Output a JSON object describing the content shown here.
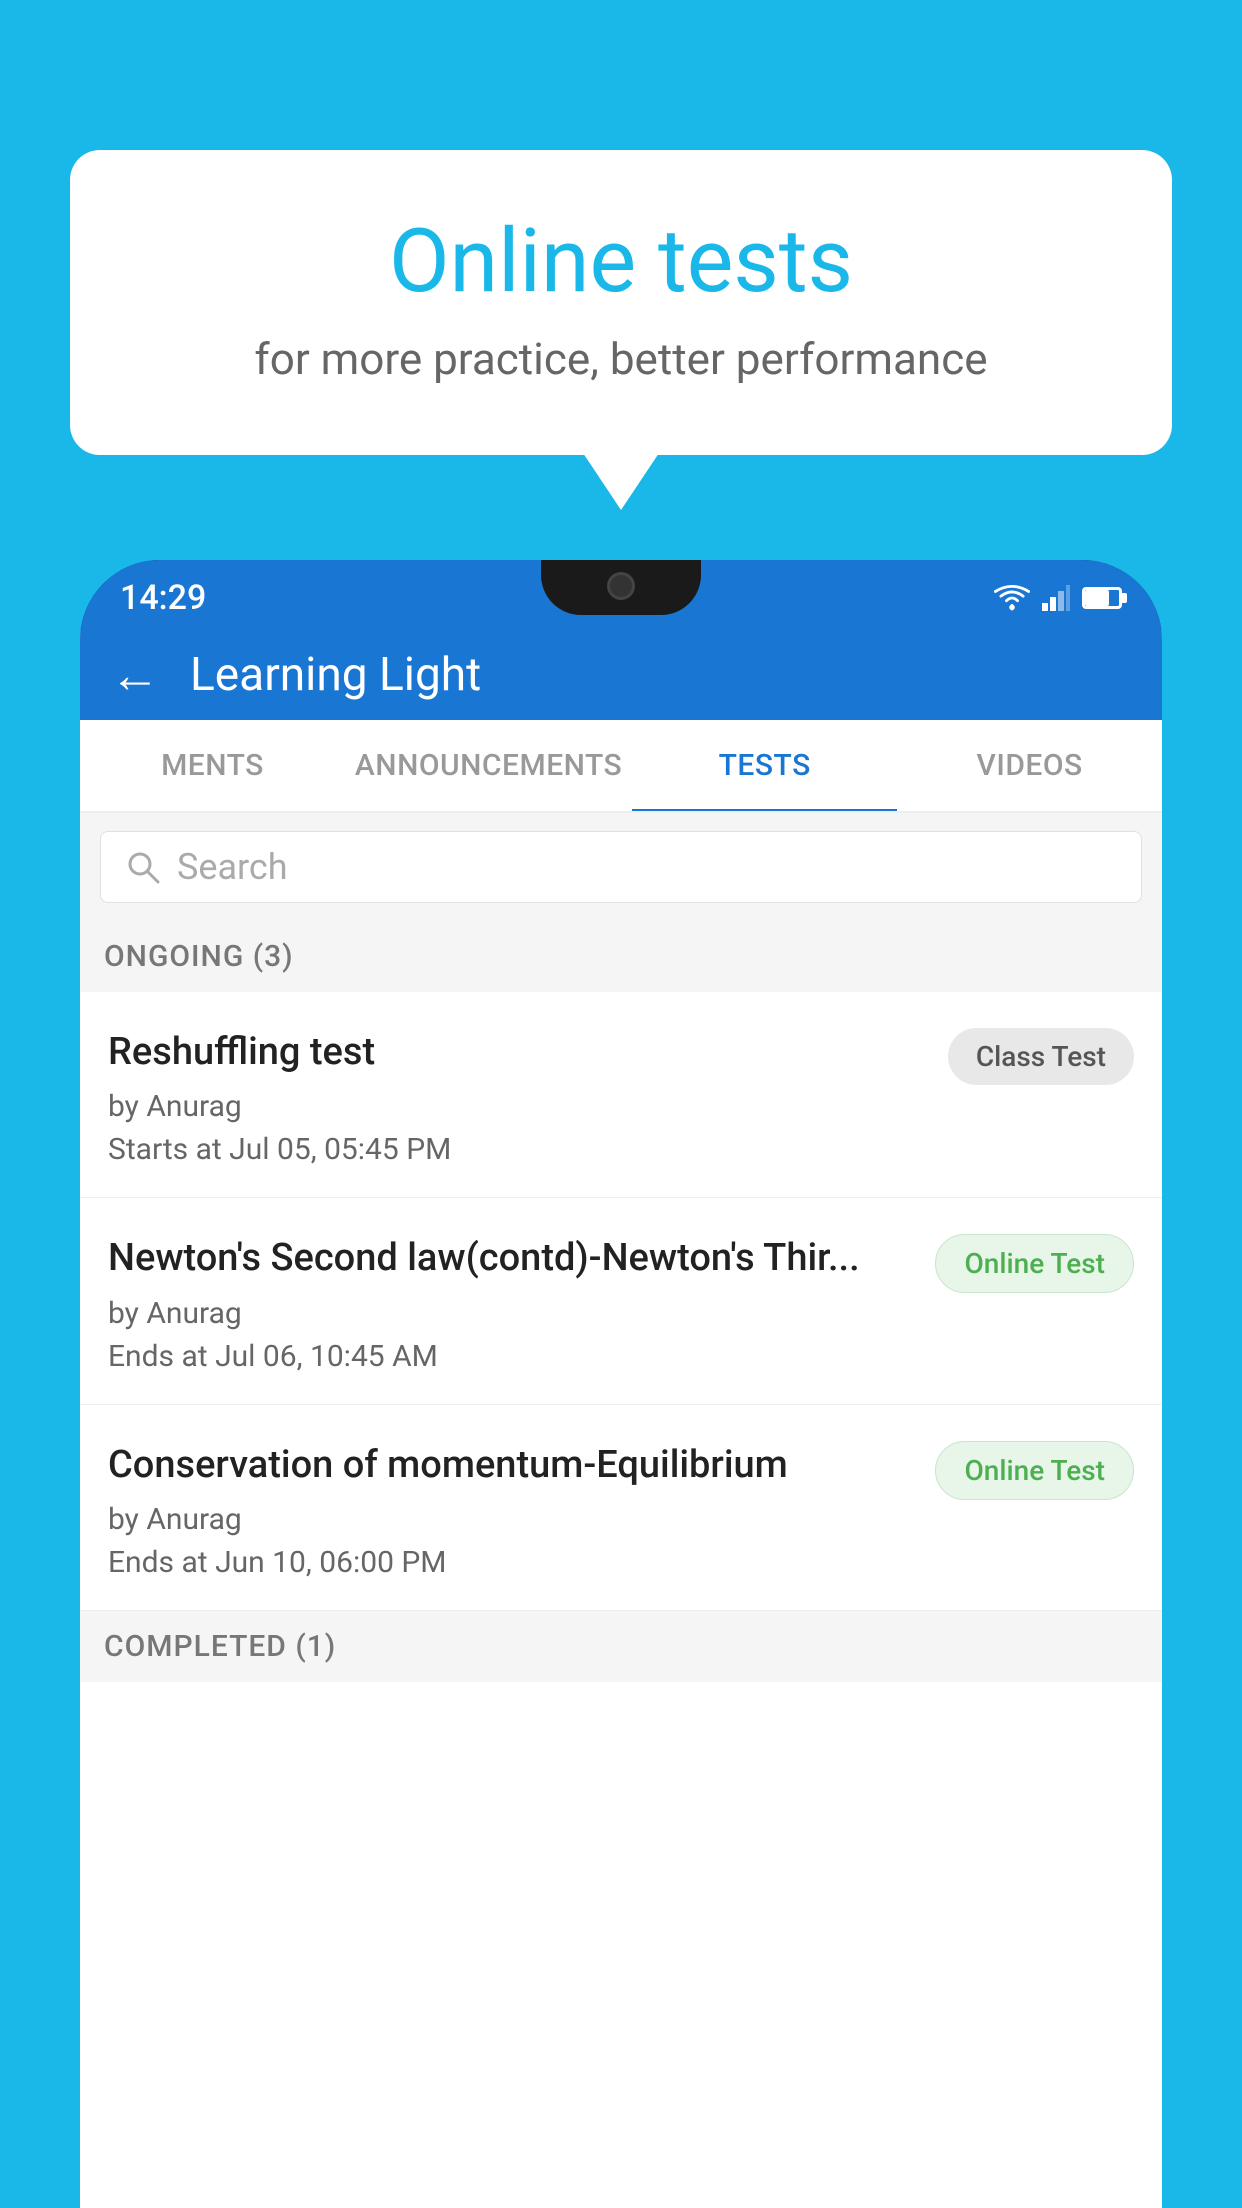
{
  "background": {
    "color": "#1ab8e8"
  },
  "speech_bubble": {
    "title": "Online tests",
    "subtitle": "for more practice, better performance"
  },
  "status_bar": {
    "time": "14:29"
  },
  "app_header": {
    "title": "Learning Light",
    "back_label": "←"
  },
  "tabs": [
    {
      "label": "MENTS",
      "active": false
    },
    {
      "label": "ANNOUNCEMENTS",
      "active": false
    },
    {
      "label": "TESTS",
      "active": true
    },
    {
      "label": "VIDEOS",
      "active": false
    }
  ],
  "search": {
    "placeholder": "Search"
  },
  "sections": [
    {
      "header": "ONGOING (3)",
      "tests": [
        {
          "title": "Reshuffling test",
          "author": "by Anurag",
          "time_label": "Starts at",
          "time": "Jul 05, 05:45 PM",
          "badge": "Class Test",
          "badge_type": "class"
        },
        {
          "title": "Newton's Second law(contd)-Newton's Thir...",
          "author": "by Anurag",
          "time_label": "Ends at",
          "time": "Jul 06, 10:45 AM",
          "badge": "Online Test",
          "badge_type": "online"
        },
        {
          "title": "Conservation of momentum-Equilibrium",
          "author": "by Anurag",
          "time_label": "Ends at",
          "time": "Jun 10, 06:00 PM",
          "badge": "Online Test",
          "badge_type": "online"
        }
      ]
    }
  ],
  "completed_header": "COMPLETED (1)"
}
